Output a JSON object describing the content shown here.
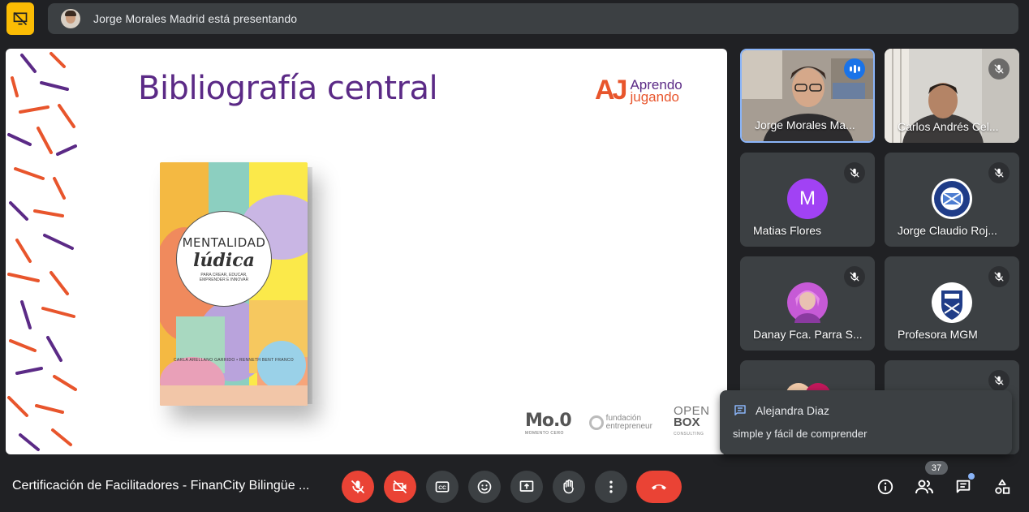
{
  "presenting": {
    "text": "Jorge Morales Madrid está presentando"
  },
  "slide": {
    "title": "Bibliografía central",
    "brand": {
      "mark": "AJ",
      "line1": "Aprendo",
      "line2": "jugando"
    },
    "book": {
      "title1": "MENTALIDAD",
      "title2": "lúdica",
      "subtitle": "PARA CREAR, EDUCAR, EMPRENDER E INNOVAR",
      "authors": "CARLA ARELLANO GARRIDO • RENNETH BENT FRANCO"
    },
    "sponsors": {
      "moo": "Mo.0",
      "moo_small": "MOMENTO CERO",
      "fund1": "fundación",
      "fund2": "entrepreneur",
      "open1": "OPEN",
      "open2": "BOX",
      "open3": "CONSULTING"
    }
  },
  "participants": [
    {
      "name": "Jorge Morales Ma...",
      "state": "speaking"
    },
    {
      "name": "Carlos Andrés Cel...",
      "state": "muted"
    },
    {
      "name": "Matias Flores",
      "initial": "M",
      "avatar_color": "#a142f4",
      "state": "muted"
    },
    {
      "name": "Jorge Claudio Roj...",
      "state": "muted"
    },
    {
      "name": "Danay Fca. Parra S...",
      "state": "muted"
    },
    {
      "name": "Profesora MGM",
      "state": "muted"
    }
  ],
  "chat_toast": {
    "sender": "Alejandra Diaz",
    "message": "simple y fácil de comprender"
  },
  "bottom_bar": {
    "meeting_title": "Certificación de Facilitadores - FinanCity Bilingüe ...",
    "participant_count": "37"
  },
  "colors": {
    "accent": "#8ab4f8",
    "danger": "#ea4335",
    "warning": "#fbbc04",
    "surface": "#3c4043",
    "background": "#202124"
  },
  "icons": {
    "top_left": "presentation-off-icon",
    "mic": "mic-off-icon",
    "camera": "videocam-off-icon",
    "captions": "closed-caption-icon",
    "emoji": "emoji-icon",
    "present": "present-screen-icon",
    "hand": "raise-hand-icon",
    "more": "more-vert-icon",
    "end": "call-end-icon",
    "info": "info-icon",
    "people": "people-icon",
    "chat": "chat-icon",
    "activities": "activities-icon"
  }
}
